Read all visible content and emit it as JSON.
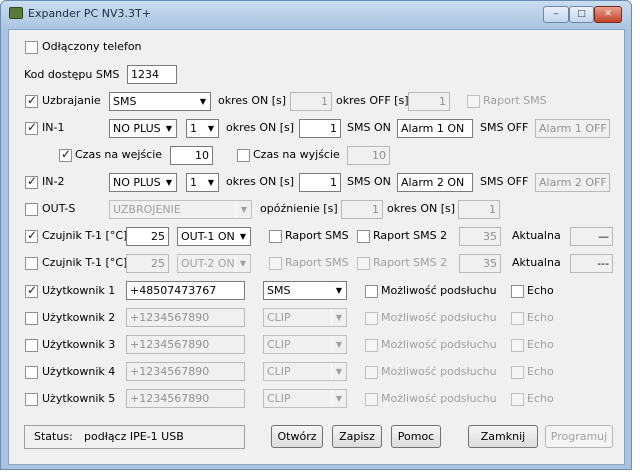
{
  "window": {
    "title": "Expander PC NV3.3T+",
    "min": "‒",
    "max": "□",
    "close": "✕"
  },
  "phone_disconnected": {
    "label": "Odłączony telefon"
  },
  "sms_code": {
    "label": "Kod dostępu SMS",
    "value": "1234"
  },
  "arming": {
    "label": "Uzbrajanie",
    "select": "SMS",
    "on_label": "okres ON [s]",
    "on_value": "1",
    "off_label": "okres OFF [s]",
    "off_value": "1",
    "report": "Raport SMS"
  },
  "in1": {
    "label": "IN-1",
    "mode": "NO PLUS",
    "num": "1",
    "on_label": "okres ON [s]",
    "on_value": "1",
    "sms_on_label": "SMS ON",
    "sms_on": "Alarm 1 ON",
    "sms_off_label": "SMS OFF",
    "sms_off": "Alarm 1 OFF"
  },
  "entry": {
    "label": "Czas na wejście",
    "value": "10",
    "exit_label": "Czas na wyjście",
    "exit_value": "10"
  },
  "in2": {
    "label": "IN-2",
    "mode": "NO PLUS",
    "num": "1",
    "on_label": "okres ON [s]",
    "on_value": "1",
    "sms_on_label": "SMS ON",
    "sms_on": "Alarm 2 ON",
    "sms_off_label": "SMS OFF",
    "sms_off": "Alarm 2 OFF"
  },
  "outs": {
    "label": "OUT-S",
    "mode": "UZBROJENIE",
    "delay_label": "opóźnienie [s]",
    "delay": "1",
    "on_label": "okres ON [s]",
    "on_value": "1"
  },
  "t1a": {
    "label": "Czujnik T-1 [°C]",
    "value": "25",
    "out": "OUT-1 ON",
    "r1": "Raport SMS",
    "r2": "Raport SMS 2",
    "v2": "35",
    "cur_label": "Aktualna",
    "cur": "—"
  },
  "t1b": {
    "label": "Czujnik T-1 [°C]",
    "value": "25",
    "out": "OUT-2 ON",
    "r1": "Raport SMS",
    "r2": "Raport SMS 2",
    "v2": "35",
    "cur_label": "Aktualna",
    "cur": "---"
  },
  "users": [
    {
      "label": "Użytkownik 1",
      "phone": "+48507473767",
      "mode": "SMS",
      "listen": "Możliwość podsłuchu",
      "echo": "Echo"
    },
    {
      "label": "Użytkownik 2",
      "phone": "+1234567890",
      "mode": "CLIP",
      "listen": "Możliwość podsłuchu",
      "echo": "Echo"
    },
    {
      "label": "Użytkownik 3",
      "phone": "+1234567890",
      "mode": "CLIP",
      "listen": "Możliwość podsłuchu",
      "echo": "Echo"
    },
    {
      "label": "Użytkownik 4",
      "phone": "+1234567890",
      "mode": "CLIP",
      "listen": "Możliwość podsłuchu",
      "echo": "Echo"
    },
    {
      "label": "Użytkownik 5",
      "phone": "+1234567890",
      "mode": "CLIP",
      "listen": "Możliwość podsłuchu",
      "echo": "Echo"
    }
  ],
  "status": {
    "label": "Status:",
    "text": "podłącz IPE-1 USB"
  },
  "buttons": {
    "open": "Otwórz",
    "save": "Zapisz",
    "help": "Pomoc",
    "close": "Zamknij",
    "program": "Programuj"
  }
}
